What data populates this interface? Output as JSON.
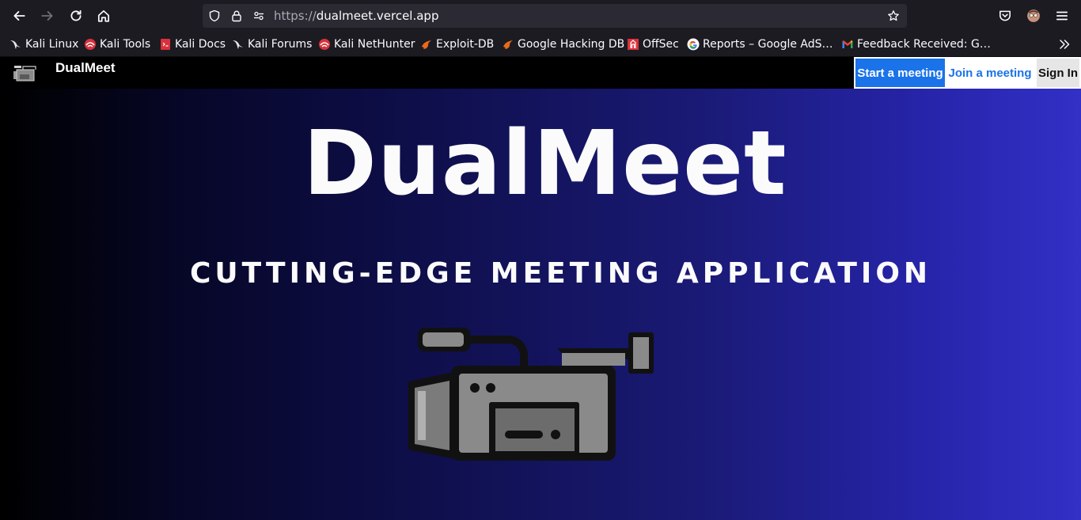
{
  "browser": {
    "url_scheme": "https://",
    "url_host": "dualmeet.vercel.app",
    "bookmarks": [
      {
        "label": "Kali Linux",
        "icon": "kali-dragon-icon"
      },
      {
        "label": "Kali Tools",
        "icon": "kali-tools-icon"
      },
      {
        "label": "Kali Docs",
        "icon": "kali-docs-icon"
      },
      {
        "label": "Kali Forums",
        "icon": "kali-dragon-icon"
      },
      {
        "label": "Kali NetHunter",
        "icon": "kali-nethunter-icon"
      },
      {
        "label": "Exploit-DB",
        "icon": "exploit-db-icon"
      },
      {
        "label": "Google Hacking DB",
        "icon": "exploit-db-icon"
      },
      {
        "label": "OffSec",
        "icon": "offsec-icon"
      },
      {
        "label": "Reports – Google AdS…",
        "icon": "google-icon"
      },
      {
        "label": "Feedback Received: G…",
        "icon": "gmail-icon"
      }
    ]
  },
  "nav": {
    "brand": "DualMeet",
    "start_label": "Start a meeting",
    "join_label": "Join a meeting",
    "signin_label": "Sign In"
  },
  "hero": {
    "title": "DualMeet",
    "subtitle": "CUTTING-EDGE MEETING APPLICATION"
  },
  "colors": {
    "primary": "#1a73e8",
    "hero_gradient_start": "#000000",
    "hero_gradient_end": "#3230c6"
  }
}
